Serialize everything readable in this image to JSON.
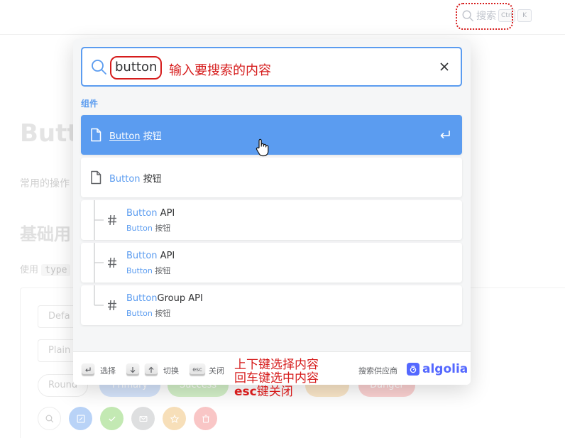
{
  "header": {
    "search_label": "搜索",
    "shortcut_keys": [
      "Ctrl",
      "K"
    ]
  },
  "background_page": {
    "title": "Butto",
    "description": "常用的操作",
    "section_title": "基础用",
    "usage_prefix": "使用",
    "usage_code": "type",
    "buttons": [
      "Defa",
      "Plain",
      "Round",
      "Primary",
      "Success",
      "Danger"
    ]
  },
  "search": {
    "query": "button",
    "query_annotation": "输入要搜索的内容"
  },
  "results": {
    "section_label": "组件",
    "page_hits": [
      {
        "highlight": "Button",
        "rest": " 按钮",
        "active": true
      },
      {
        "highlight": "Button",
        "rest": " 按钮",
        "active": false
      }
    ],
    "heading_hits": [
      {
        "highlight": "Button",
        "rest": " API",
        "path_highlight": "Button",
        "path_rest": " 按钮"
      },
      {
        "highlight": "Button",
        "rest": " API",
        "path_highlight": "Button",
        "path_rest": " 按钮"
      },
      {
        "highlight": "Button",
        "rest": "Group API",
        "path_highlight": "Button",
        "path_rest": " 按钮"
      }
    ]
  },
  "footer": {
    "select_label": "选择",
    "switch_label": "切换",
    "esc_key": "esc",
    "close_label": "关闭",
    "provider_label": "搜索供应商",
    "brand": "algolia"
  },
  "annotations": {
    "nav": "上下键选择内容",
    "enter": "回车键选中内容",
    "esc_key": "esc",
    "esc_rest": "键关闭"
  },
  "colors": {
    "accent": "#5b9cf0",
    "annotation_red": "#d61c1c",
    "algolia": "#5468ff"
  }
}
